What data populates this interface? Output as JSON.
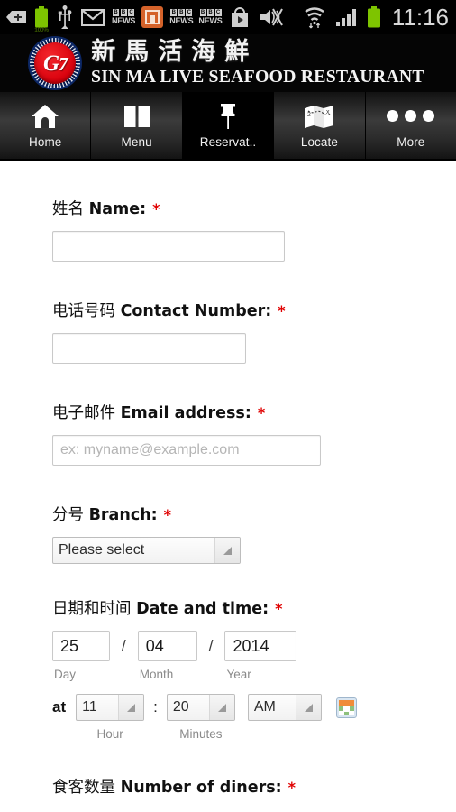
{
  "statusbar": {
    "icons": [
      {
        "name": "back-tag-icon",
        "glyph": "tag-arrow"
      },
      {
        "name": "battery-full-icon",
        "glyph": "battery",
        "label": "100%"
      },
      {
        "name": "usb-icon",
        "glyph": "usb"
      },
      {
        "name": "gmail-icon",
        "glyph": "envelope-m"
      },
      {
        "name": "bbc-news-icon-1",
        "glyph": "bbc",
        "top": [
          "B",
          "B",
          "C"
        ],
        "bottom": "NEWS"
      },
      {
        "name": "app-orange-icon",
        "glyph": "orange-square"
      },
      {
        "name": "bbc-news-icon-2",
        "glyph": "bbc",
        "top": [
          "B",
          "B",
          "C"
        ],
        "bottom": "NEWS"
      },
      {
        "name": "bbc-news-icon-3",
        "glyph": "bbc",
        "top": [
          "B",
          "B",
          "C"
        ],
        "bottom": "NEWS"
      },
      {
        "name": "play-store-icon",
        "glyph": "play-bag"
      },
      {
        "name": "sound-mute-icon",
        "glyph": "speaker-muted"
      },
      {
        "name": "wifi-icon",
        "glyph": "wifi-updown"
      },
      {
        "name": "cellular-signal-icon",
        "glyph": "signal-bars"
      },
      {
        "name": "battery-icon",
        "glyph": "battery"
      }
    ],
    "battery_percent": "100%",
    "clock": "11:16"
  },
  "banner": {
    "logo_text": "G",
    "logo_suffix": "7",
    "chinese_title": "新馬活海鮮",
    "english_title": "SIN MA LIVE SEAFOOD RESTAURANT"
  },
  "nav": {
    "items": [
      {
        "label": "Home",
        "icon": "home-icon",
        "active": false
      },
      {
        "label": "Menu",
        "icon": "book-icon",
        "active": false
      },
      {
        "label": "Reservat..",
        "icon": "pin-icon",
        "active": true
      },
      {
        "label": "Locate",
        "icon": "map-icon",
        "active": false
      },
      {
        "label": "More",
        "icon": "more-dots-icon",
        "active": false
      }
    ]
  },
  "form": {
    "required_mark": "*",
    "name": {
      "label_cn": "姓名 ",
      "label_en": "Name:",
      "value": "",
      "placeholder": ""
    },
    "contact": {
      "label_cn": "电话号码 ",
      "label_en": "Contact Number:",
      "value": "",
      "placeholder": ""
    },
    "email": {
      "label_cn": "电子邮件 ",
      "label_en": "Email address:",
      "value": "",
      "placeholder": "ex: myname@example.com"
    },
    "branch": {
      "label_cn": "分号 ",
      "label_en": "Branch:",
      "selected": "Please select"
    },
    "datetime": {
      "label_cn": "日期和时间 ",
      "label_en": "Date and time:",
      "day": "25",
      "month": "04",
      "year": "2014",
      "day_caption": "Day",
      "month_caption": "Month",
      "year_caption": "Year",
      "separator": "/",
      "at_label": "at",
      "hour": "11",
      "minutes": "20",
      "meridiem": "AM",
      "hour_caption": "Hour",
      "minutes_caption": "Minutes",
      "time_separator": ":",
      "calendar_icon": "calendar-picker-icon"
    },
    "diners": {
      "label_cn": "食客数量 ",
      "label_en": "Number of diners:"
    }
  },
  "colors": {
    "required_red": "#e00000",
    "banner_bg": "#050505",
    "nav_active_bg": "#000000",
    "logo_red": "#d8000c",
    "logo_navy": "#0a1a4a"
  }
}
